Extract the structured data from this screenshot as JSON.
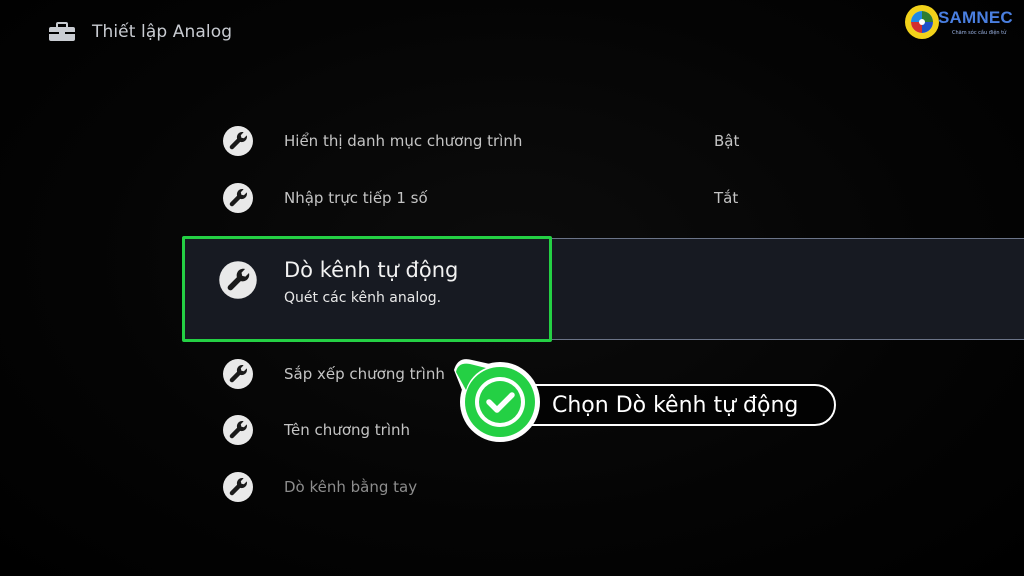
{
  "header": {
    "title": "Thiết lập Analog",
    "icon": "toolbox-icon"
  },
  "logo": {
    "brand": "SAMNEC",
    "tagline": "Chăm sóc cầu điện tử"
  },
  "menu": {
    "items": [
      {
        "label": "Hiển thị danh mục chương trình",
        "value": "Bật",
        "icon": "wrench-icon"
      },
      {
        "label": "Nhập trực tiếp 1 số",
        "value": "Tắt",
        "icon": "wrench-icon"
      },
      {
        "label": "Dò kênh tự động",
        "description": "Quét các kênh analog.",
        "icon": "wrench-icon",
        "selected": true
      },
      {
        "label": "Sắp xếp chương trình",
        "icon": "wrench-icon"
      },
      {
        "label": "Tên chương trình",
        "icon": "wrench-icon"
      },
      {
        "label": "Dò kênh bằng tay",
        "icon": "wrench-icon"
      }
    ]
  },
  "callout": {
    "text": "Chọn Dò kênh tự động",
    "icon": "checkmark-icon",
    "color": "#24d044"
  },
  "colors": {
    "highlight": "#24d044",
    "background": "#000000",
    "brand": "#4a7fe0"
  }
}
